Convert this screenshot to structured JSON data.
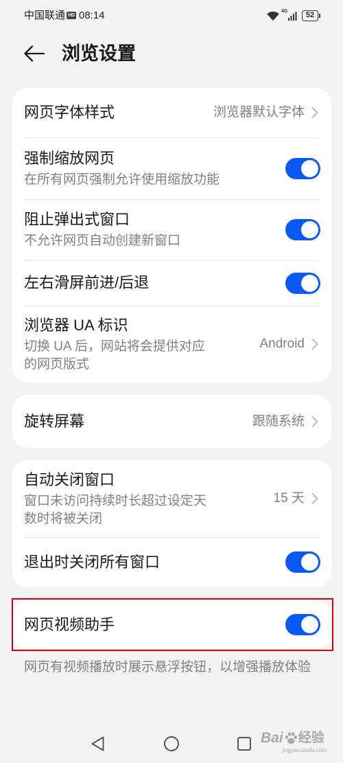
{
  "status_bar": {
    "carrier": "中国联通",
    "hd_badge": "HD",
    "time": "08:14",
    "network_type": "4G",
    "battery_percent": "52",
    "icons": [
      "wifi-icon",
      "signal-icon",
      "battery-icon"
    ]
  },
  "header": {
    "back_icon": "arrow-left-icon",
    "title": "浏览设置"
  },
  "groups": [
    {
      "items": [
        {
          "title": "网页字体样式",
          "value": "浏览器默认字体",
          "chevron_icon": "chevron-right-icon"
        },
        {
          "title": "强制缩放网页",
          "subtitle": "在所有网页强制允许使用缩放功能",
          "toggle_on": true
        },
        {
          "title": "阻止弹出式窗口",
          "subtitle": "不允许网页自动创建新窗口",
          "toggle_on": true
        },
        {
          "title": "左右滑屏前进/后退",
          "toggle_on": true
        },
        {
          "title": "浏览器 UA 标识",
          "subtitle": "切换 UA 后，网站将会提供对应的网页版式",
          "value": "Android",
          "chevron_icon": "chevron-right-icon"
        }
      ]
    },
    {
      "items": [
        {
          "title": "旋转屏幕",
          "value": "跟随系统",
          "chevron_icon": "chevron-right-icon"
        }
      ]
    },
    {
      "items": [
        {
          "title": "自动关闭窗口",
          "subtitle": "窗口未访问持续时长超过设定天数时将被关闭",
          "value": "15 天",
          "chevron_icon": "chevron-right-icon"
        },
        {
          "title": "退出时关闭所有窗口",
          "toggle_on": true
        }
      ]
    },
    {
      "highlight_frame": true,
      "items": [
        {
          "title": "网页视频助手",
          "toggle_on": true
        }
      ]
    }
  ],
  "footer_note": "网页有视频播放时展示悬浮按钮，以增强播放体验",
  "nav_bar": {
    "icons": [
      "triangle-back-icon",
      "circle-home-icon",
      "square-recents-icon"
    ]
  },
  "watermark": {
    "brand": "Bai",
    "product": "经验",
    "url": "jingyan.baidu.com"
  },
  "colors": {
    "background": "#F1F3F5",
    "card": "#FFFFFF",
    "accent": "#0A59F7",
    "text_primary": "#191919",
    "text_secondary": "#808080",
    "divider": "#E6E6E6",
    "highlight_frame": "#D7000F"
  }
}
